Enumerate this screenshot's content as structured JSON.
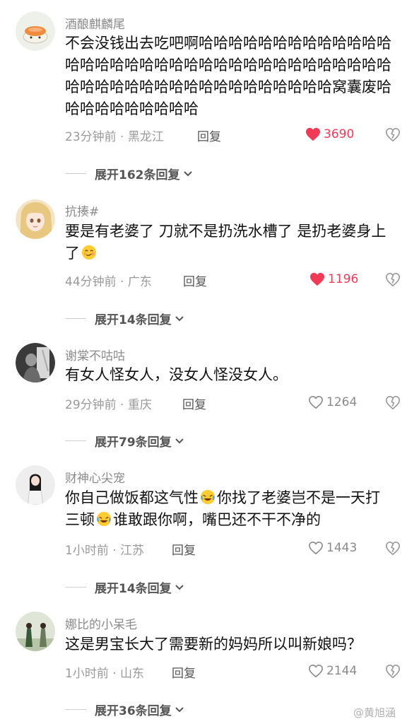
{
  "comments": [
    {
      "username": "酒酿麒麟尾",
      "text": "不会没钱出去吃吧啊哈哈哈哈哈哈哈哈哈哈哈哈哈哈哈哈哈哈哈哈哈哈哈哈哈哈哈哈哈哈哈哈哈哈哈哈哈哈哈哈哈哈哈哈哈哈哈哈哈哈哈哈哈窝囊废哈哈哈哈哈哈哈哈哈哈",
      "time_location": "23分钟前 · 黑龙江",
      "reply_label": "回复",
      "likes": "3690",
      "liked": true,
      "expand_label": "展开162条回复"
    },
    {
      "username": "抗揍#",
      "text": "要是有老婆了 刀就不是扔洗水槽了 是扔老婆身上了",
      "emoji_trailing": "blush-emoji",
      "time_location": "44分钟前 · 广东",
      "reply_label": "回复",
      "likes": "1196",
      "liked": true,
      "expand_label": "展开14条回复"
    },
    {
      "username": "谢棠不咕咕",
      "text": "有女人怪女人，没女人怪没女人。",
      "time_location": "29分钟前 · 重庆",
      "reply_label": "回复",
      "likes": "1264",
      "liked": false,
      "expand_label": "展开79条回复"
    },
    {
      "username": "财神心尖宠",
      "text_parts": [
        "你自己做饭都这气性",
        "你找了老婆岂不是一天打三顿",
        "谁敢跟你啊，嘴巴还不干不净的"
      ],
      "emoji_inline": "rofl-emoji",
      "time_location": "1小时前 · 江苏",
      "reply_label": "回复",
      "likes": "1443",
      "liked": false,
      "expand_label": "展开14条回复"
    },
    {
      "username": "娜比的小呆毛",
      "text": "这是男宝长大了需要新的妈妈所以叫新娘吗？",
      "time_location": "1小时前 · 山东",
      "reply_label": "回复",
      "likes": "2144",
      "liked": false,
      "expand_label": "展开36条回复"
    }
  ],
  "watermark": "@黄旭涵",
  "colors": {
    "like_active": "#f03a56",
    "meta_gray": "#9a9a9a",
    "text": "#111111"
  }
}
